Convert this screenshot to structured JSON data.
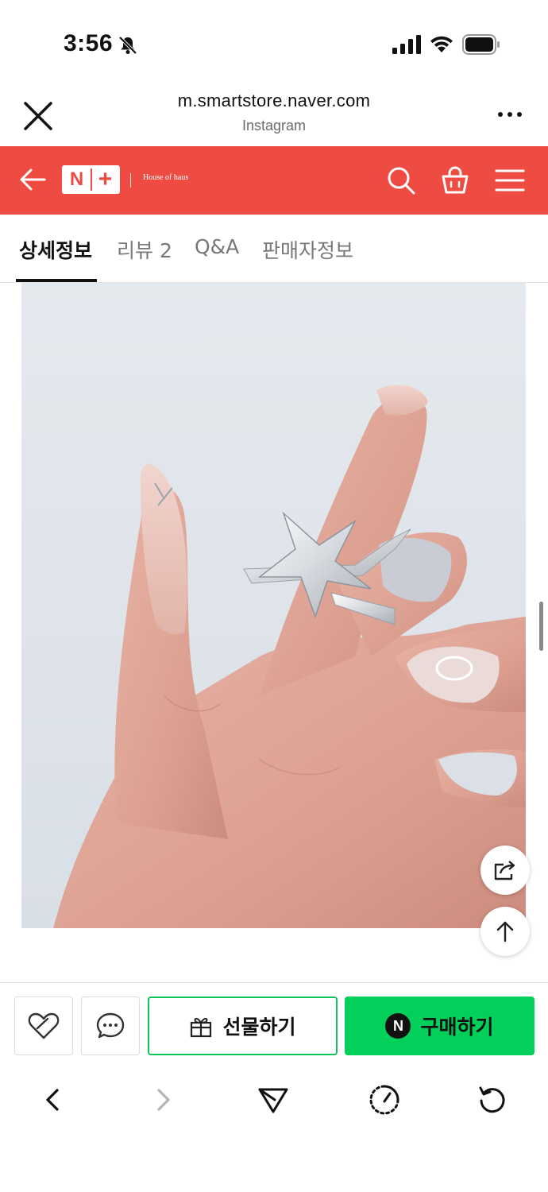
{
  "status_bar": {
    "time": "3:56"
  },
  "browser": {
    "url": "m.smartstore.naver.com",
    "referrer": "Instagram"
  },
  "store_nav": {
    "logo_n": "N",
    "brand": "House of haus",
    "accent_color": "#ee4b43"
  },
  "tabs": [
    {
      "label": "상세정보",
      "active": true
    },
    {
      "label": "리뷰 2",
      "active": false
    },
    {
      "label": "Q&A",
      "active": false
    },
    {
      "label": "판매자정보",
      "active": false
    }
  ],
  "actions": {
    "gift_label": "선물하기",
    "buy_label": "구매하기",
    "npay_badge": "N",
    "buy_color": "#03d05a"
  },
  "icons": {
    "status": [
      "bell-slash-icon",
      "signal-icon",
      "wifi-icon",
      "battery-icon"
    ],
    "header": [
      "close-icon",
      "more-icon"
    ],
    "nav": [
      "back-arrow-icon",
      "search-icon",
      "cart-icon",
      "menu-icon"
    ],
    "floating": [
      "share-icon",
      "arrow-up-icon"
    ],
    "bottom": [
      "heart-icon",
      "chat-icon",
      "gift-icon"
    ],
    "toolbar": [
      "chevron-left-icon",
      "chevron-right-icon",
      "send-icon",
      "speed-icon",
      "refresh-icon"
    ]
  }
}
